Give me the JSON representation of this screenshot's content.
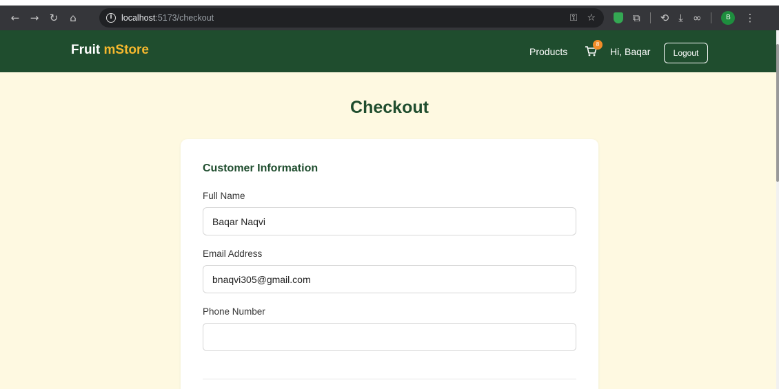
{
  "browser": {
    "url_host": "localhost",
    "url_path": ":5173/checkout",
    "profile_initial": "B"
  },
  "header": {
    "logo_main": "Fruit",
    "logo_accent": "mStore",
    "nav_products": "Products",
    "cart_count": "8",
    "greeting": "Hi, Baqar",
    "logout_label": "Logout"
  },
  "page": {
    "title": "Checkout",
    "section_title": "Customer Information",
    "fields": {
      "full_name_label": "Full Name",
      "full_name_value": "Baqar Naqvi",
      "email_label": "Email Address",
      "email_value": "bnaqvi305@gmail.com",
      "phone_label": "Phone Number",
      "phone_value": ""
    }
  },
  "colors": {
    "header_bg": "#1f4d2e",
    "accent": "#f5b82e",
    "page_bg": "#fef9e1",
    "badge": "#f28c28"
  }
}
